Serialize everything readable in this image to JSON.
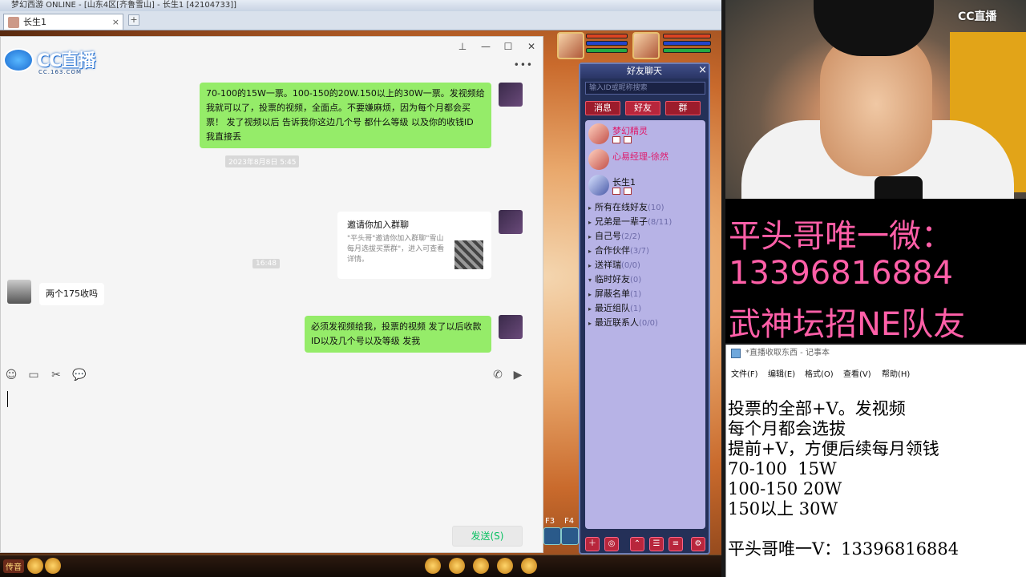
{
  "game": {
    "title": "梦幻西游 ONLINE - [山东4区[齐鲁雪山] - 长生1 [42104733]]",
    "tab_label": "长生1",
    "tab_close": "×",
    "tab_new": "+",
    "friends_panel": {
      "title": "好友聊天",
      "close": "×",
      "search_placeholder": "输入ID或昵称搜索",
      "tabs": [
        "消息",
        "好友",
        "群"
      ],
      "friends": [
        {
          "name": "梦幻精灵"
        },
        {
          "name": "心易经理-徐然"
        },
        {
          "name": "长生1"
        }
      ],
      "groups": [
        {
          "arrow": "▸",
          "label": "所有在线好友",
          "count": "(10)"
        },
        {
          "arrow": "▸",
          "label": "兄弟是一辈子",
          "count": "(8/11)"
        },
        {
          "arrow": "▸",
          "label": "自己号",
          "count": "(2/2)"
        },
        {
          "arrow": "▸",
          "label": "合作伙伴",
          "count": "(3/7)"
        },
        {
          "arrow": "▸",
          "label": "送祥瑞",
          "count": "(0/0)"
        },
        {
          "arrow": "▾",
          "label": "临时好友",
          "count": "(0)"
        },
        {
          "arrow": "▸",
          "label": "屏蔽名单",
          "count": "(1)"
        },
        {
          "arrow": "▸",
          "label": "最近组队",
          "count": "(1)"
        },
        {
          "arrow": "▸",
          "label": "最近联系人",
          "count": "(0/0)"
        }
      ],
      "toolbar": [
        "＋",
        "◎",
        "⌃",
        "☰",
        "≡",
        "⚙"
      ]
    },
    "fkeys": [
      "F3",
      "F4"
    ],
    "bottombar_label": "传音"
  },
  "chat": {
    "window_controls": {
      "pin": "⊥",
      "minimize": "—",
      "maximize": "☐",
      "close": "✕",
      "more": "•••"
    },
    "messages": [
      {
        "text": "70-100的15W一票。100-150的20W.150以上的30W一票。发视频给我就可以了，投票的视频，全面点。不要嫌麻烦，因为每个月都会买票！ 发了视频以后 告诉我你这边几个号 都什么等级 以及你的收钱ID 我直接丢"
      },
      {
        "text": "两个175收吗"
      },
      {
        "text": "必须发视频给我，投票的视频 发了以后收款ID以及几个号以及等级 发我"
      }
    ],
    "timestamps": [
      "2023年8月8日 5:45",
      "16:48"
    ],
    "invite": {
      "title": "邀请你加入群聊",
      "desc": "\"平头哥\"邀请你加入群聊\"雪山每月选拔买票群\"，进入可查看详情。"
    },
    "toolbar_icons": [
      "☺",
      "▭",
      "✂",
      "💬",
      "✆",
      "▶"
    ],
    "send_label": "发送(S)"
  },
  "cc_logo": {
    "brand": "CC直播",
    "domain": "CC.163.COM",
    "overlay_text": "直播"
  },
  "cc_watermark": "CC直播",
  "overlay_lines": [
    "平头哥唯一微：",
    "13396816884",
    "武神坛招NE队友"
  ],
  "notepad": {
    "title": "*直播收取东西 - 记事本",
    "menu": [
      "文件(F)",
      "编辑(E)",
      "格式(O)",
      "查看(V)",
      "帮助(H)"
    ],
    "lines": [
      "投票的全部+V。发视频",
      "每个月都会选拔",
      "提前+V，方便后续每月领钱",
      "70-100  15W",
      "100-150 20W",
      "150以上 30W",
      "",
      "平头哥唯一V：13396816884"
    ]
  },
  "colors": {
    "wechat_green": "#95ec69",
    "send_green": "#07c160",
    "overlay_pink": "#ff5fa8",
    "friends_tab_red": "#b8263c"
  }
}
